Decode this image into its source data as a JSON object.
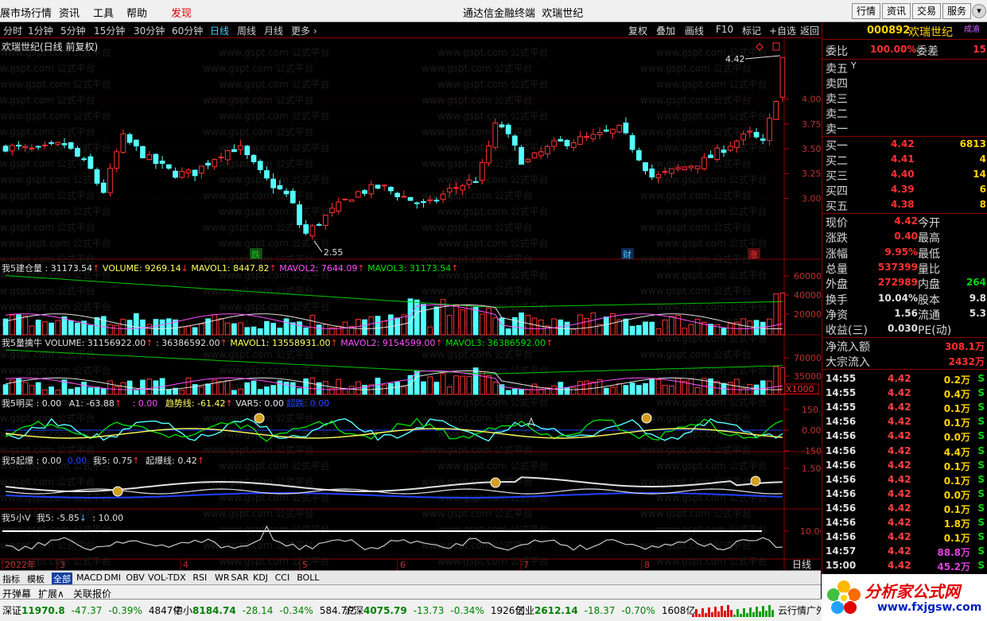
{
  "menubar": {
    "items": [
      "展市场行情",
      "资讯",
      "工具",
      "帮助",
      "发现"
    ],
    "app_title": "通达信金融终端",
    "app_stock": "欢瑞世纪",
    "buttons": [
      "行情",
      "资讯",
      "交易",
      "服务"
    ]
  },
  "periodbar": {
    "periods": [
      "分时",
      "1分钟",
      "5分钟",
      "15分钟",
      "30分钟",
      "60分钟",
      "日线",
      "周线",
      "月线",
      "更多"
    ],
    "active": "日线",
    "tools": [
      "复权",
      "叠加",
      "画线",
      "F10",
      "标记",
      "+自选",
      "返回"
    ]
  },
  "chart": {
    "title": "欢瑞世纪(日线 前复权)",
    "high_label": "4.42",
    "low_label": "2.55",
    "price_ticks": [
      "4.00",
      "3.75",
      "3.50",
      "3.25",
      "3.00"
    ],
    "markers": [
      "跌",
      "财",
      "涨"
    ],
    "date_labels": [
      "2022年",
      "3",
      "4",
      "5",
      "6",
      "7",
      "8"
    ],
    "period_label": "日线",
    "watermark_text": "www.gspt.com 公式平台"
  },
  "indicators": {
    "vol1": {
      "name": "我5建仓量 : 31173.54",
      "parts": [
        "VOLUME: 9269.14",
        "MAVOL1: 8447.82",
        "MAVOL2: 7644.09",
        "MAVOL3: 31173.54"
      ],
      "ticks": [
        "60000",
        "40000",
        "20000"
      ]
    },
    "vol2": {
      "name": "我5量擒牛",
      "parts": [
        "VOLUME: 31156922.00",
        ": 36386592.00",
        "MAVOL1: 13558931.00",
        "MAVOL2: 9154599.00",
        "MAVOL3: 36386592.00"
      ],
      "ticks": [
        "70000",
        "35000"
      ],
      "unit": "X1000"
    },
    "osc": {
      "name": "我5明买 : 0.00",
      "parts": [
        "A1: -63.88",
        ": 0.00",
        "趋势线: -61.42",
        "VAR5: 0.00",
        "超跌: 0.00"
      ],
      "ticks": [
        "150.0",
        "0.00",
        "-150.0"
      ]
    },
    "burst": {
      "name": "我5起爆 : 0.00",
      "parts": [
        "0.00",
        "我5: 0.75",
        "起爆线: 0.42"
      ],
      "ticks": [
        "1.50"
      ]
    },
    "small": {
      "name": "我5小V",
      "parts": [
        "我5: -5.85",
        ": 10.00"
      ],
      "ticks": [
        "10.00"
      ]
    }
  },
  "quote": {
    "code": "000892",
    "name": "欢瑞世纪",
    "tag": "成渝",
    "wei_bi_label": "委比",
    "wei_bi": "100.00%",
    "wei_cha_label": "委差",
    "wei_cha": "15",
    "sell_labels": [
      "卖五",
      "卖四",
      "卖三",
      "卖二",
      "卖一"
    ],
    "sell_mark": "Y",
    "buy": [
      {
        "label": "买一",
        "price": "4.42",
        "vol": "6813"
      },
      {
        "label": "买二",
        "price": "4.41",
        "vol": "4"
      },
      {
        "label": "买三",
        "price": "4.40",
        "vol": "14"
      },
      {
        "label": "买四",
        "price": "4.39",
        "vol": "6"
      },
      {
        "label": "买五",
        "price": "4.38",
        "vol": "8"
      }
    ],
    "stats": [
      {
        "l1": "现价",
        "v1": "4.42",
        "l2": "今开",
        "v2": ""
      },
      {
        "l1": "涨跌",
        "v1": "0.40",
        "l2": "最高",
        "v2": ""
      },
      {
        "l1": "涨幅",
        "v1": "9.95%",
        "l2": "最低",
        "v2": ""
      },
      {
        "l1": "总量",
        "v1": "537399",
        "l2": "量比",
        "v2": ""
      },
      {
        "l1": "外盘",
        "v1": "272989",
        "l2": "内盘",
        "v2": "264"
      },
      {
        "l1": "换手",
        "v1": "10.04%",
        "l2": "股本",
        "v2": "9.8"
      },
      {
        "l1": "净资",
        "v1": "1.56",
        "l2": "流通",
        "v2": "5.3"
      },
      {
        "l1": "收益(三)",
        "v1": "0.030",
        "l2": "PE(动)",
        "v2": ""
      }
    ],
    "flow": [
      {
        "label": "净流入额",
        "value": "308.1万"
      },
      {
        "label": "大宗流入",
        "value": "2432万"
      }
    ],
    "ticks": [
      {
        "t": "14:55",
        "p": "4.42",
        "v": "0.2万",
        "s": "S"
      },
      {
        "t": "14:55",
        "p": "4.42",
        "v": "0.4万",
        "s": "S"
      },
      {
        "t": "14:55",
        "p": "4.42",
        "v": "0.1万",
        "s": "S"
      },
      {
        "t": "14:56",
        "p": "4.42",
        "v": "0.1万",
        "s": "S"
      },
      {
        "t": "14:56",
        "p": "4.42",
        "v": "0.0万",
        "s": "S"
      },
      {
        "t": "14:56",
        "p": "4.42",
        "v": "4.4万",
        "s": "S"
      },
      {
        "t": "14:56",
        "p": "4.42",
        "v": "0.1万",
        "s": "S"
      },
      {
        "t": "14:56",
        "p": "4.42",
        "v": "0.1万",
        "s": "S"
      },
      {
        "t": "14:56",
        "p": "4.42",
        "v": "0.0万",
        "s": "S"
      },
      {
        "t": "14:56",
        "p": "4.42",
        "v": "0.1万",
        "s": "S"
      },
      {
        "t": "14:56",
        "p": "4.42",
        "v": "1.8万",
        "s": "S"
      },
      {
        "t": "14:56",
        "p": "4.42",
        "v": "0.1万",
        "s": "S"
      },
      {
        "t": "14:57",
        "p": "4.42",
        "v": "88.8万",
        "s": "S"
      },
      {
        "t": "15:00",
        "p": "4.42",
        "v": "45.2万",
        "s": "S"
      }
    ]
  },
  "indicator_tabs": [
    "指标",
    "模板",
    "全部",
    "MACD",
    "DMI",
    "OBV",
    "VOL-TDX",
    "RSI",
    "WR",
    "SAR",
    "KDJ",
    "CCI",
    "BOLL"
  ],
  "indicator_tab_active": "全部",
  "bottom_tabs": [
    "开弹幕",
    "扩展∧",
    "关联报价"
  ],
  "statusbar": {
    "items": [
      {
        "name": "深证",
        "price": "11970.8",
        "chg": "-47.37",
        "pct": "-0.39%",
        "amt": "4847亿"
      },
      {
        "name": "中小",
        "price": "8184.74",
        "chg": "-28.14",
        "pct": "-0.34%",
        "amt": "584.7亿"
      },
      {
        "name": "沪深",
        "price": "4075.79",
        "chg": "-13.73",
        "pct": "-0.34%",
        "amt": "1926亿"
      },
      {
        "name": "创业",
        "price": "2612.14",
        "chg": "-18.37",
        "pct": "-0.70%",
        "amt": "1608亿"
      }
    ],
    "right_text": "云行情广外"
  },
  "watermark": {
    "text": "分析家公式网",
    "url": "www.fxjgsw.com"
  },
  "colors": {
    "up": "#ff3232",
    "down": "#54ffff",
    "ma_green": "#00c800",
    "ma_white": "#e0e0e0",
    "ma_magenta": "#ff50ff",
    "ma_yellow": "#ffff60",
    "grid_red": "#8a0000"
  }
}
